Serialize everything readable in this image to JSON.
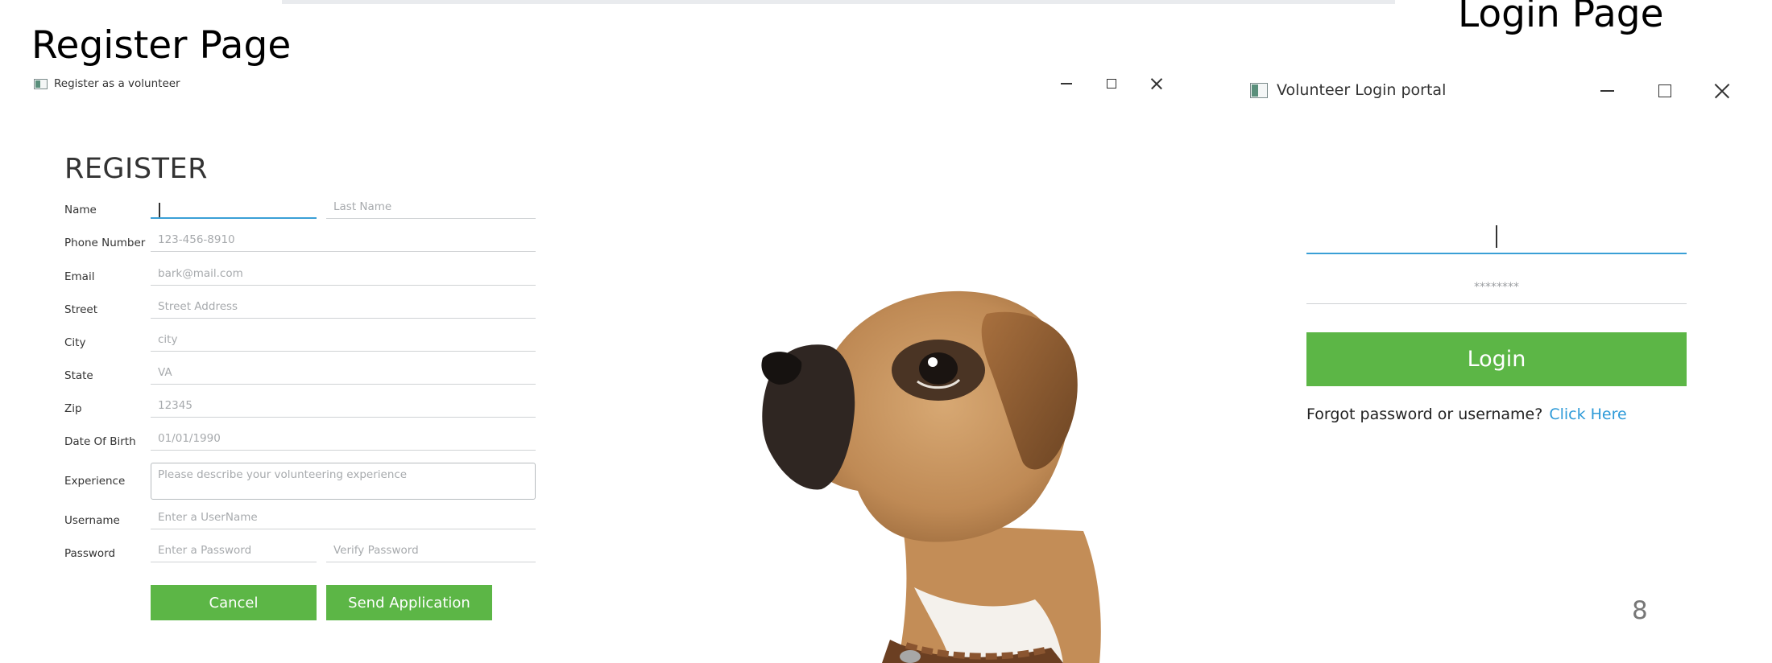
{
  "slide": {
    "register_title": "Register Page",
    "login_title": "Login Page",
    "page_number": "8"
  },
  "register_window": {
    "title": "Register as a volunteer",
    "heading": "REGISTER",
    "fields": {
      "name_label": "Name",
      "first_name_value": "",
      "last_name_placeholder": "Last Name",
      "phone_label": "Phone Number",
      "phone_placeholder": "123-456-8910",
      "email_label": "Email",
      "email_placeholder": "bark@mail.com",
      "street_label": "Street",
      "street_placeholder": "Street Address",
      "city_label": "City",
      "city_placeholder": "city",
      "state_label": "State",
      "state_placeholder": "VA",
      "zip_label": "Zip",
      "zip_placeholder": "12345",
      "dob_label": "Date Of Birth",
      "dob_placeholder": "01/01/1990",
      "experience_label": "Experience",
      "experience_placeholder": "Please describe your volunteering experience",
      "username_label": "Username",
      "username_placeholder": "Enter a UserName",
      "password_label": "Password",
      "password_placeholder": "Enter a Password",
      "verify_placeholder": "Verify Password"
    },
    "buttons": {
      "cancel": "Cancel",
      "send": "Send Application"
    }
  },
  "login_window": {
    "title": "Volunteer Login portal",
    "username_value": "",
    "password_placeholder": "********",
    "login_button": "Login",
    "forgot_text": "Forgot password or username?",
    "forgot_link": "Click Here"
  },
  "colors": {
    "button_green": "#5cb646",
    "focus_blue": "#3a9fd6",
    "link_blue": "#2d9ad8"
  },
  "icons": [
    "app-icon",
    "minimize-icon",
    "maximize-icon",
    "close-icon"
  ],
  "image": "puppy-photo"
}
